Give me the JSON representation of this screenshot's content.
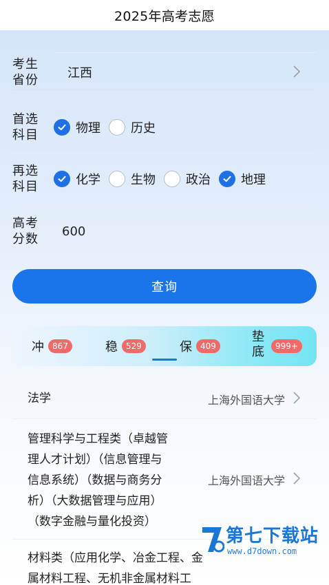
{
  "header": {
    "title": "2025年高考志愿"
  },
  "form": {
    "province": {
      "label": "考生省份",
      "value": "江西"
    },
    "first_subject": {
      "label": "首选科目",
      "options": [
        {
          "label": "物理",
          "checked": true
        },
        {
          "label": "历史",
          "checked": false
        }
      ]
    },
    "second_subject": {
      "label": "再选科目",
      "options": [
        {
          "label": "化学",
          "checked": true
        },
        {
          "label": "生物",
          "checked": false
        },
        {
          "label": "政治",
          "checked": false
        },
        {
          "label": "地理",
          "checked": true
        }
      ]
    },
    "score": {
      "label": "高考分数",
      "value": "600"
    }
  },
  "query_button": {
    "label": "查询"
  },
  "tabs": [
    {
      "label": "冲",
      "count": "867",
      "active": false
    },
    {
      "label": "稳",
      "count": "529",
      "active": false
    },
    {
      "label": "保",
      "count": "409",
      "active": true
    },
    {
      "label": "垫底",
      "count": "999+",
      "active": false
    }
  ],
  "results": [
    {
      "major_lines": [
        "法学"
      ],
      "school": "上海外国语大学"
    },
    {
      "major_lines": [
        "管理科学与工程类（卓越管",
        "理人才计划）（信息管理与",
        "信息系统）（数据与商务分",
        "析）（大数据管理与应用）",
        "（数字金融与量化投资）"
      ],
      "school": "上海外国语大学"
    },
    {
      "major_lines": [
        "材料类（应用化学、冶金工程、金",
        "属材料工程、无机非金属材料工"
      ],
      "school": ""
    }
  ],
  "watermark": {
    "name": "第七下载站",
    "url": "www.d7down.com"
  },
  "colors": {
    "accent": "#1a74ea",
    "badge": "#f06a6a"
  },
  "icons": {
    "check": "check-icon",
    "chevron": "chevron-right-icon"
  }
}
